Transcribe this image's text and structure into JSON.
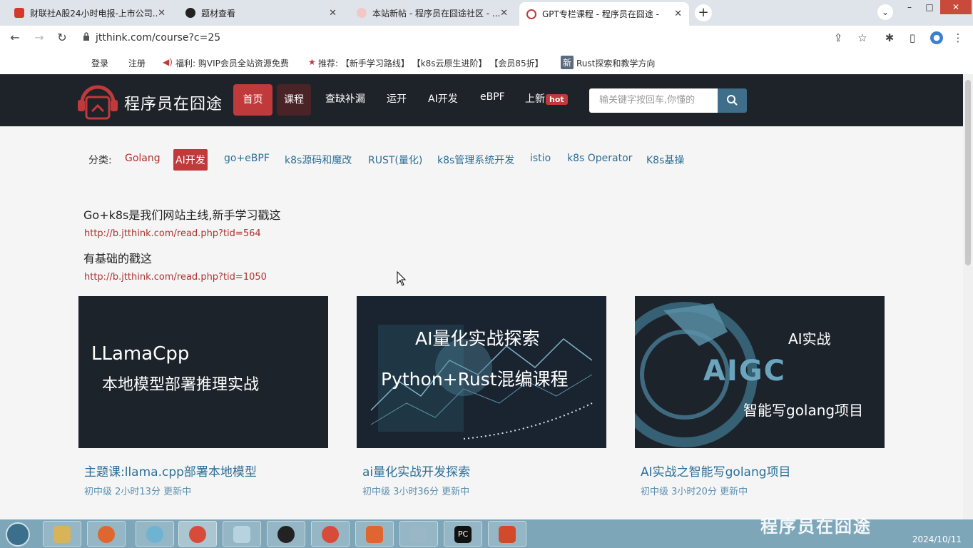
{
  "browser": {
    "tabs": [
      {
        "title": "财联社A股24小时电报-上市公司..."
      },
      {
        "title": "题材查看"
      },
      {
        "title": "本站新帖 - 程序员在囧途社区 - ..."
      },
      {
        "title": "GPT专栏课程 - 程序员在囧途 -"
      }
    ],
    "url": "jtthink.com/course?c=25",
    "bookmarks": [
      "登录",
      "注册",
      "福利: 购VIP会员全站资源免费",
      "推荐: 【新手学习路线】 【k8s云原生进阶】 【会员85折】",
      "Rust探索和教学方向"
    ],
    "bookmark_badge": "新"
  },
  "site": {
    "name": "程序员在囧途",
    "nav": [
      "首页",
      "课程",
      "查缺补漏",
      "运开",
      "AI开发",
      "eBPF",
      "上新"
    ],
    "hot_badge": "hot",
    "search_placeholder": "输关键字按回车,你懂的"
  },
  "categories": {
    "label": "分类:",
    "items": [
      "Golang",
      "AI开发",
      "go+eBPF",
      "k8s源码和魔改",
      "RUST(量化)",
      "k8s管理系统开发",
      "istio",
      "k8s Operator",
      "K8s基操"
    ],
    "active": "AI开发"
  },
  "intro": {
    "line1": "Go+k8s是我们网站主线,新手学习戳这",
    "link1": "http://b.jtthink.com/read.php?tid=564",
    "line2": "有基础的戳这",
    "link2": "http://b.jtthink.com/read.php?tid=1050"
  },
  "courses": [
    {
      "thumb_line1": "LLamaCpp",
      "thumb_line2": "本地模型部署推理实战",
      "title": "主题课:llama.cpp部署本地模型",
      "meta": "初中级 2小时13分 更新中"
    },
    {
      "thumb_line1": "AI量化实战探索",
      "thumb_line2": "Python+Rust混编课程",
      "title": "ai量化实战开发探索",
      "meta": "初中级 3小时36分 更新中"
    },
    {
      "thumb_line1": "AI实战",
      "thumb_line2": "智能写golang项目",
      "thumb_logo": "AIGC",
      "title": "AI实战之智能写golang项目",
      "meta": "初中级 3小时20分 更新中"
    }
  ],
  "taskbar": {
    "date": "2024/10/11",
    "watermark": "程序员在囧途"
  },
  "colors": {
    "brand_red": "#c0393b",
    "header_bg": "#1e2329",
    "link_blue": "#2d6f96"
  }
}
